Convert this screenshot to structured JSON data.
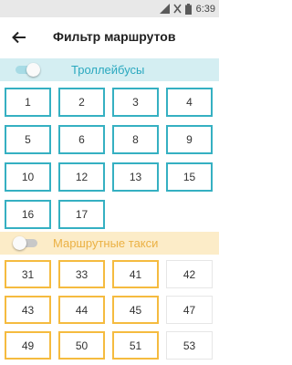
{
  "status_bar": {
    "time": "6:39",
    "icons": [
      "signal-icon",
      "no-sim-icon",
      "battery-icon"
    ]
  },
  "app_bar": {
    "back_icon": "arrow-left-icon",
    "title": "Фильтр маршрутов"
  },
  "sections": {
    "trolley": {
      "title": "Троллейбусы",
      "toggle_on": true,
      "accent": "#35b0c2",
      "header_bg": "#d4eef2",
      "routes": [
        "1",
        "2",
        "3",
        "4",
        "5",
        "6",
        "8",
        "9",
        "10",
        "12",
        "13",
        "15",
        "16",
        "17"
      ]
    },
    "taxi": {
      "title": "Маршрутные такси",
      "toggle_on": false,
      "accent": "#f5bb3f",
      "header_bg": "#fcecc8",
      "routes": [
        {
          "label": "31",
          "selected": true
        },
        {
          "label": "33",
          "selected": true
        },
        {
          "label": "41",
          "selected": true
        },
        {
          "label": "42",
          "selected": false
        },
        {
          "label": "43",
          "selected": true
        },
        {
          "label": "44",
          "selected": true
        },
        {
          "label": "45",
          "selected": true
        },
        {
          "label": "47",
          "selected": false
        },
        {
          "label": "49",
          "selected": true
        },
        {
          "label": "50",
          "selected": true
        },
        {
          "label": "51",
          "selected": true
        },
        {
          "label": "53",
          "selected": false
        }
      ]
    }
  }
}
